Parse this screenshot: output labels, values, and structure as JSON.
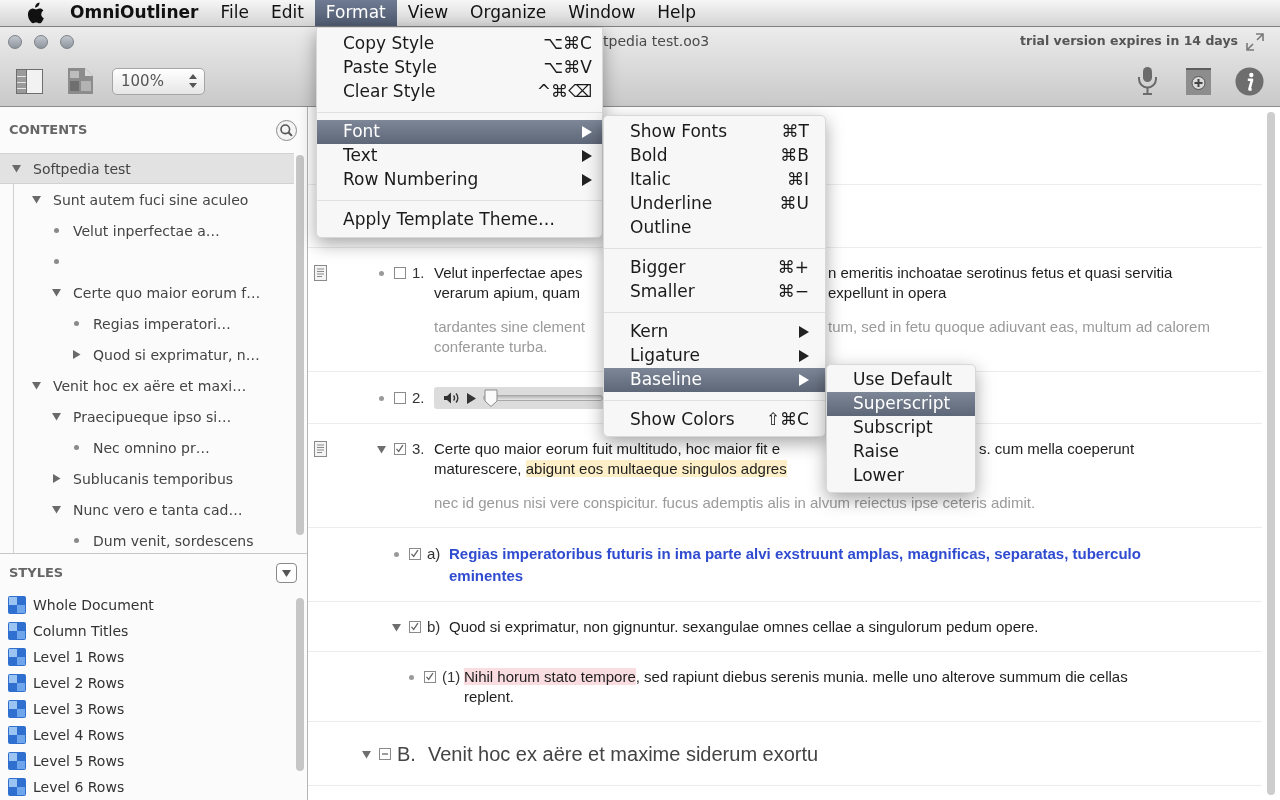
{
  "menubar": {
    "app_name": "OmniOutliner",
    "menus": [
      {
        "label": "File",
        "selected": false
      },
      {
        "label": "Edit",
        "selected": false
      },
      {
        "label": "Format",
        "selected": true
      },
      {
        "label": "View",
        "selected": false
      },
      {
        "label": "Organize",
        "selected": false
      },
      {
        "label": "Window",
        "selected": false
      },
      {
        "label": "Help",
        "selected": false
      }
    ]
  },
  "format_menu": {
    "items": [
      {
        "kind": "command",
        "label": "Copy Style",
        "shortcut": "⌥⌘C",
        "selected": false
      },
      {
        "kind": "command",
        "label": "Paste Style",
        "shortcut": "⌥⌘V",
        "selected": false
      },
      {
        "kind": "command",
        "label": "Clear Style",
        "shortcut": "^⌘⌫",
        "selected": false
      },
      {
        "kind": "separator"
      },
      {
        "kind": "submenu",
        "label": "Font",
        "selected": true
      },
      {
        "kind": "submenu",
        "label": "Text",
        "selected": false
      },
      {
        "kind": "submenu",
        "label": "Row Numbering",
        "selected": false
      },
      {
        "kind": "separator"
      },
      {
        "kind": "command",
        "label": "Apply Template Theme…",
        "selected": false
      }
    ]
  },
  "font_submenu": {
    "items": [
      {
        "kind": "command",
        "label": "Show Fonts",
        "shortcut": "⌘T",
        "selected": false
      },
      {
        "kind": "command",
        "label": "Bold",
        "shortcut": "⌘B",
        "selected": false
      },
      {
        "kind": "command",
        "label": "Italic",
        "shortcut": "⌘I",
        "selected": false
      },
      {
        "kind": "command",
        "label": "Underline",
        "shortcut": "⌘U",
        "selected": false
      },
      {
        "kind": "command",
        "label": "Outline",
        "selected": false
      },
      {
        "kind": "separator"
      },
      {
        "kind": "command",
        "label": "Bigger",
        "shortcut": "⌘+",
        "selected": false
      },
      {
        "kind": "command",
        "label": "Smaller",
        "shortcut": "⌘−",
        "selected": false
      },
      {
        "kind": "separator"
      },
      {
        "kind": "submenu",
        "label": "Kern",
        "selected": false
      },
      {
        "kind": "submenu",
        "label": "Ligature",
        "selected": false
      },
      {
        "kind": "submenu",
        "label": "Baseline",
        "selected": true
      },
      {
        "kind": "separator"
      },
      {
        "kind": "command",
        "label": "Show Colors",
        "shortcut": "⇧⌘C",
        "selected": false
      }
    ]
  },
  "baseline_submenu": {
    "items": [
      {
        "kind": "command",
        "label": "Use Default",
        "selected": false
      },
      {
        "kind": "command",
        "label": "Superscript",
        "selected": true
      },
      {
        "kind": "command",
        "label": "Subscript",
        "selected": false
      },
      {
        "kind": "command",
        "label": "Raise",
        "selected": false
      },
      {
        "kind": "command",
        "label": "Lower",
        "selected": false
      }
    ]
  },
  "window": {
    "title": "tpedia test.oo3",
    "trial_notice": "trial version expires in 14 days"
  },
  "toolbar": {
    "zoom": "100%"
  },
  "sidebar": {
    "contents_heading": "CONTENTS",
    "tree": [
      {
        "label": "Softpedia test",
        "selected": true,
        "expanded": true,
        "children": [
          {
            "label": "Sunt autem fuci sine aculeo",
            "selected": false,
            "expanded": true,
            "children": [
              {
                "label": "Velut inperfectae a…",
                "selected": false
              },
              {
                "selected": false
              },
              {
                "label": "Certe quo maior eorum f…",
                "selected": false,
                "expanded": true,
                "children": [
                  {
                    "label": "Regias imperatori…",
                    "selected": false
                  },
                  {
                    "label": "Quod si exprimatur, n…",
                    "selected": false,
                    "expanded": false
                  }
                ]
              }
            ]
          },
          {
            "label": "Venit hoc ex aëre et maxi…",
            "selected": false,
            "expanded": true,
            "children": [
              {
                "label": "Praecipueque ipso si…",
                "selected": false,
                "expanded": true,
                "children": [
                  {
                    "label": "Nec omnino pr…",
                    "selected": false
                  }
                ]
              },
              {
                "label": "Sublucanis temporibus",
                "selected": false,
                "expanded": false
              },
              {
                "label": "Nunc vero e tanta cad…",
                "selected": false,
                "expanded": true,
                "children": [
                  {
                    "label": "Dum venit, sordescens",
                    "selected": false
                  }
                ]
              }
            ]
          }
        ]
      }
    ],
    "styles_heading": "STYLES",
    "styles": [
      "Whole Document",
      "Column Titles",
      "Level 1 Rows",
      "Level 2 Rows",
      "Level 3 Rows",
      "Level 4 Rows",
      "Level 5 Rows",
      "Level 6 Rows"
    ]
  },
  "outline": {
    "rows": [
      {
        "kind": "heading",
        "children": [
          {
            "kind": "item",
            "has_note": true,
            "checked": false,
            "mixed": false,
            "number": "1.",
            "bold": false,
            "lines": [
              {
                "kind": "mid",
                "parts": [
                  {
                    "text": "Velut inperfectae apes"
                  }
                ],
                "continued": "n emeritis inchoatae serotinus fetus et quasi servitia"
              },
              {
                "kind": "mid",
                "parts": [
                  {
                    "text": "verarum apium, quam"
                  }
                ],
                "continued": "expellunt in opera"
              }
            ],
            "note_lines": [
              {
                "kind": "mid",
                "parts": [
                  {
                    "text": "tardantes sine clement"
                  }
                ],
                "continued": "tum, sed in fetu quoque adiuvant eas, multum ad calorem"
              },
              {
                "kind": "plain",
                "parts": [
                  {
                    "text": "conferante turba."
                  }
                ]
              }
            ]
          },
          {
            "kind": "audio",
            "has_note": false,
            "checked": false,
            "mixed": false,
            "number": "2.",
            "level": 0
          },
          {
            "kind": "item",
            "has_note": true,
            "expanded": true,
            "checked": true,
            "mixed": false,
            "number": "3.",
            "bold": false,
            "lines": [
              {
                "kind": "late",
                "parts": [
                  {
                    "text": "Certe quo maior eorum fuit multitudo, hoc maior fit e"
                  }
                ],
                "continued": "s. cum mella coeperunt"
              },
              {
                "kind": "late",
                "parts": [
                  {
                    "text": "maturescere, "
                  },
                  {
                    "text": "abigunt eos multaeque singulos adgres",
                    "color": "#fdf0c9"
                  }
                ]
              }
            ],
            "note_lines": [
              {
                "kind": "plain",
                "parts": [
                  {
                    "text": "nec id genus nisi vere conspicitur. fucus ademptis alis in alvum reiectus ipse ceteris adimit."
                  }
                ]
              }
            ],
            "children": [
              {
                "kind": "item",
                "has_note": false,
                "checked": true,
                "mixed": false,
                "number": "a)",
                "bold": true,
                "color": "#2f4bd0",
                "lines": [
                  {
                    "kind": "plain",
                    "parts": [
                      {
                        "text": "Regias imperatoribus futuris in ima parte alvi exstruunt amplas, magnificas, separatas, tuberculo"
                      }
                    ]
                  },
                  {
                    "kind": "plain",
                    "parts": [
                      {
                        "text": "eminentes"
                      }
                    ]
                  }
                ]
              },
              {
                "kind": "item",
                "has_note": false,
                "expanded": true,
                "checked": true,
                "mixed": false,
                "number": "b)",
                "bold": false,
                "lines": [
                  {
                    "kind": "plain",
                    "parts": [
                      {
                        "text": "Quod si exprimatur, non gignuntur. sexangulae omnes cellae a singulorum pedum opere."
                      }
                    ]
                  }
                ],
                "children": [
                  {
                    "kind": "item",
                    "has_note": false,
                    "checked": true,
                    "mixed": false,
                    "number": "(1)",
                    "bold": false,
                    "lines": [
                      {
                        "kind": "plain",
                        "parts": [
                          {
                            "text": "Nihil horum stato tempore",
                            "color": "#f9dde1"
                          },
                          {
                            "text": ", sed rapiunt diebus serenis munia. melle uno alterove summum die cellas"
                          }
                        ]
                      },
                      {
                        "kind": "plain",
                        "parts": [
                          {
                            "text": "replent."
                          }
                        ]
                      }
                    ]
                  }
                ]
              }
            ]
          }
        ]
      },
      {
        "kind": "heading",
        "has_note": false,
        "expanded": true,
        "mixed": true,
        "number": "B.",
        "lines": [
          {
            "kind": "plain",
            "parts": [
              {
                "text": "Venit hoc ex aëre et maxime siderum exortu"
              }
            ]
          }
        ]
      }
    ]
  }
}
